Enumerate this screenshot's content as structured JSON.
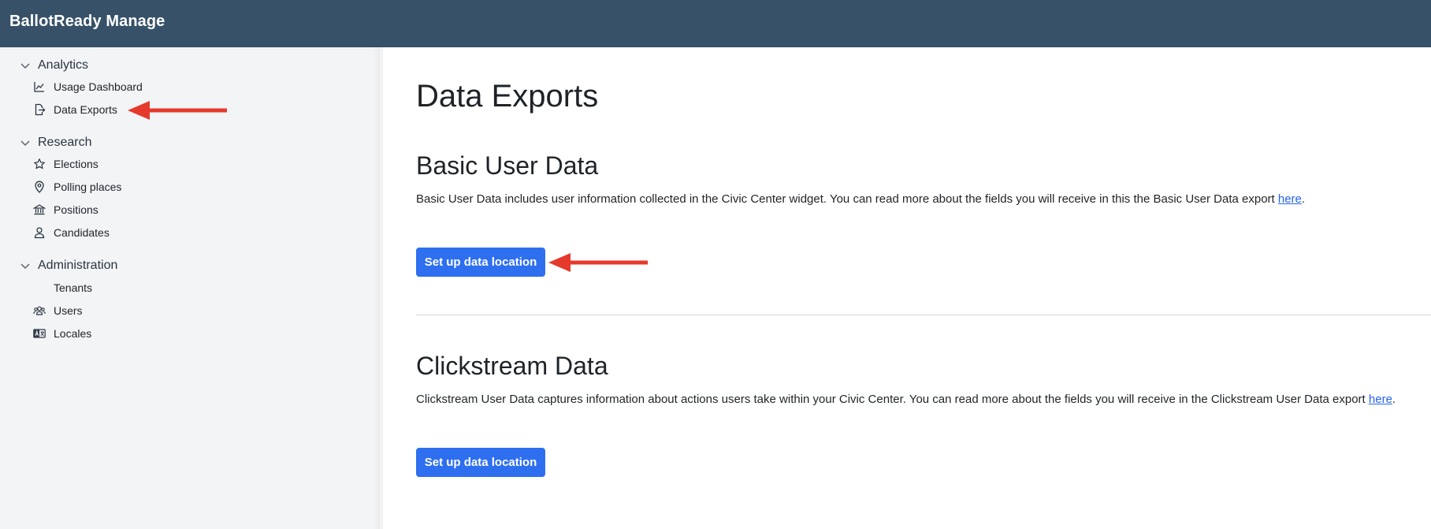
{
  "header": {
    "app_title": "BallotReady Manage"
  },
  "sidebar": {
    "groups": [
      {
        "label": "Analytics",
        "items": [
          {
            "label": "Usage Dashboard",
            "icon": "line-chart-icon"
          },
          {
            "label": "Data Exports",
            "icon": "file-export-icon"
          }
        ]
      },
      {
        "label": "Research",
        "items": [
          {
            "label": "Elections",
            "icon": "star-icon"
          },
          {
            "label": "Polling places",
            "icon": "map-pin-icon"
          },
          {
            "label": "Positions",
            "icon": "government-building-icon"
          },
          {
            "label": "Candidates",
            "icon": "user-icon"
          }
        ]
      },
      {
        "label": "Administration",
        "items": [
          {
            "label": "Tenants",
            "icon": ""
          },
          {
            "label": "Users",
            "icon": "users-icon"
          },
          {
            "label": "Locales",
            "icon": "language-icon"
          }
        ]
      }
    ]
  },
  "main": {
    "page_title": "Data Exports",
    "sections": [
      {
        "title": "Basic User Data",
        "description": "Basic User Data includes user information collected in the Civic Center widget. You can read more about the fields you will receive in this the Basic User Data export ",
        "link_text": "here",
        "suffix": ".",
        "button_label": "Set up data location"
      },
      {
        "title": "Clickstream Data",
        "description": "Clickstream User Data captures information about actions users take within your Civic Center. You can read more about the fields you will receive in the Clickstream User Data export ",
        "link_text": "here",
        "suffix": ".",
        "button_label": "Set up data location"
      }
    ]
  },
  "colors": {
    "topbar": "#375168",
    "sidebar": "#f2f4f6",
    "primary_button": "#2e6ff0",
    "link": "#2563eb",
    "annotation_arrow": "#e5392b"
  }
}
